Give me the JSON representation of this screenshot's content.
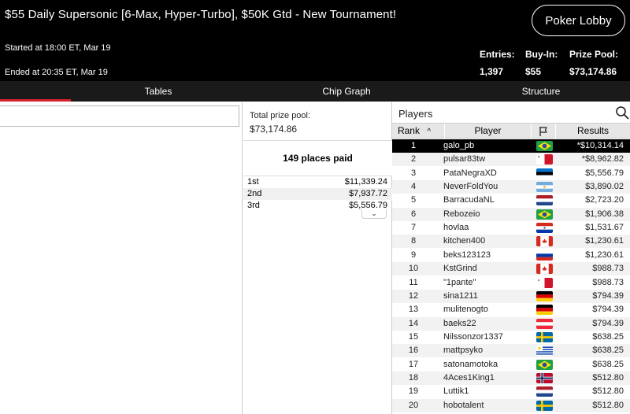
{
  "header": {
    "title": "$55 Daily Supersonic [6-Max, Hyper-Turbo], $50K Gtd - New Tournament!",
    "lobby_button": "Poker Lobby",
    "started": "Started at 18:00 ET, Mar 19",
    "ended": "Ended at 20:35 ET, Mar 19",
    "stats": {
      "entries_label": "Entries:",
      "entries_value": "1,397",
      "buyin_label": "Buy-In:",
      "buyin_value": "$55",
      "prizepool_label": "Prize Pool:",
      "prizepool_value": "$73,174.86"
    }
  },
  "tabs": [
    {
      "label": "Tables",
      "active": true
    },
    {
      "label": "Chip Graph",
      "active": false
    },
    {
      "label": "Structure",
      "active": false
    }
  ],
  "prize": {
    "total_label": "Total prize pool:",
    "total_value": "$73,174.86",
    "places_paid": "149 places paid",
    "rows": [
      {
        "place": "1st",
        "amount": "$11,339.24"
      },
      {
        "place": "2nd",
        "amount": "$7,937.72"
      },
      {
        "place": "3rd",
        "amount": "$5,556.79"
      }
    ]
  },
  "players": {
    "title": "Players",
    "columns": {
      "rank": "Rank",
      "player": "Player",
      "results": "Results"
    },
    "rows": [
      {
        "rank": "1",
        "name": "galo_pb",
        "flag": "brazil-flag",
        "result": "*$10,314.14"
      },
      {
        "rank": "2",
        "name": "pulsar83tw",
        "flag": "malta-flag",
        "result": "*$8,962.82"
      },
      {
        "rank": "3",
        "name": "PataNegraXD",
        "flag": "estonia-flag",
        "result": "$5,556.79"
      },
      {
        "rank": "4",
        "name": "NeverFoldYou",
        "flag": "argentina-flag",
        "result": "$3,890.02"
      },
      {
        "rank": "5",
        "name": "BarracudaNL",
        "flag": "netherlands-flag",
        "result": "$2,723.20"
      },
      {
        "rank": "6",
        "name": "Rebozeio",
        "flag": "brazil-flag",
        "result": "$1,906.38"
      },
      {
        "rank": "7",
        "name": "hovlaa",
        "flag": "paraguay-flag",
        "result": "$1,531.67"
      },
      {
        "rank": "8",
        "name": "kitchen400",
        "flag": "canada-flag",
        "result": "$1,230.61"
      },
      {
        "rank": "9",
        "name": "beks123123",
        "flag": "russia-flag",
        "result": "$1,230.61"
      },
      {
        "rank": "10",
        "name": "KstGrind",
        "flag": "canada-flag",
        "result": "$988.73"
      },
      {
        "rank": "11",
        "name": "\"1pante\"",
        "flag": "malta-flag",
        "result": "$988.73"
      },
      {
        "rank": "12",
        "name": "sina1211",
        "flag": "germany-flag",
        "result": "$794.39"
      },
      {
        "rank": "13",
        "name": "mulitenogto",
        "flag": "germany-flag",
        "result": "$794.39"
      },
      {
        "rank": "14",
        "name": "baeks22",
        "flag": "austria-flag",
        "result": "$794.39"
      },
      {
        "rank": "15",
        "name": "Nilssonzor1337",
        "flag": "sweden-flag",
        "result": "$638.25"
      },
      {
        "rank": "16",
        "name": "mattpsyko",
        "flag": "uruguay-flag",
        "result": "$638.25"
      },
      {
        "rank": "17",
        "name": "satonamotoka",
        "flag": "brazil-flag",
        "result": "$638.25"
      },
      {
        "rank": "18",
        "name": "4Aces1King1",
        "flag": "norway-flag",
        "result": "$512.80"
      },
      {
        "rank": "19",
        "name": "Luttik1",
        "flag": "netherlands-flag",
        "result": "$512.80"
      },
      {
        "rank": "20",
        "name": "hobotalent",
        "flag": "sweden-flag",
        "result": "$512.80"
      }
    ]
  },
  "colors": {
    "tab_indicator": "#d4202a",
    "header_bg": "#000000",
    "selected_row": "#000000"
  }
}
